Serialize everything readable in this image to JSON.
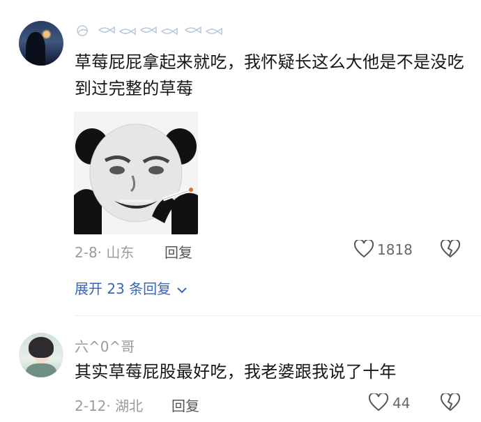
{
  "comments": [
    {
      "username_display": "decorative-fish-name",
      "text": "草莓屁屁拿起来就吃，我怀疑长这么大他是不是没吃到过完整的草莓",
      "date_location": "2-8· 山东",
      "reply_label": "回复",
      "likes": "1818",
      "expand_replies": "展开 23 条回复"
    },
    {
      "username": "六^0^哥",
      "text": "其实草莓屁股最好吃，我老婆跟我说了十年",
      "date_location": "2-12· 湖北",
      "reply_label": "回复",
      "likes": "44"
    }
  ],
  "icons": {
    "like": "heart-outline-icon",
    "dislike": "broken-heart-icon",
    "chevron": "chevron-down-icon"
  },
  "colors": {
    "link": "#3b65b3",
    "meta": "#9b9b9b"
  }
}
